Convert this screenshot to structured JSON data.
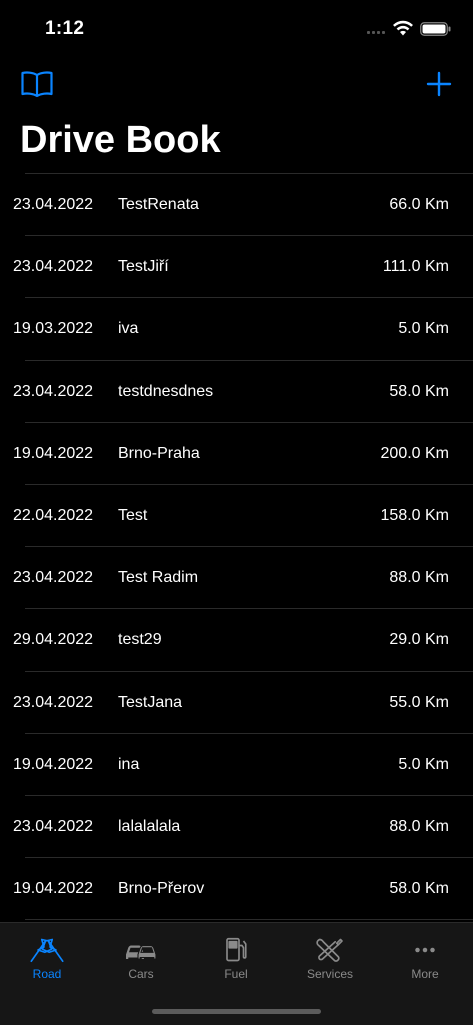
{
  "status_bar": {
    "time": "1:12"
  },
  "nav": {
    "title": "Drive Book",
    "left_icon": "book-icon",
    "right_icon": "plus-icon"
  },
  "colors": {
    "accent": "#0a84ff",
    "background": "#000000",
    "tab_inactive": "#8a8a8a"
  },
  "rides": [
    {
      "date": "23.04.2022",
      "name": "TestRenata",
      "distance": "66.0 Km"
    },
    {
      "date": "23.04.2022",
      "name": "TestJiří",
      "distance": "111.0 Km"
    },
    {
      "date": "19.03.2022",
      "name": "iva",
      "distance": "5.0 Km"
    },
    {
      "date": "23.04.2022",
      "name": "testdnesdnes",
      "distance": "58.0 Km"
    },
    {
      "date": "19.04.2022",
      "name": "Brno-Praha",
      "distance": "200.0 Km"
    },
    {
      "date": "22.04.2022",
      "name": "Test",
      "distance": "158.0 Km"
    },
    {
      "date": "23.04.2022",
      "name": "Test Radim",
      "distance": "88.0 Km"
    },
    {
      "date": "29.04.2022",
      "name": "test29",
      "distance": "29.0 Km"
    },
    {
      "date": "23.04.2022",
      "name": "TestJana",
      "distance": "55.0 Km"
    },
    {
      "date": "19.04.2022",
      "name": "ina",
      "distance": "5.0 Km"
    },
    {
      "date": "23.04.2022",
      "name": "lalalalala",
      "distance": "88.0 Km"
    },
    {
      "date": "19.04.2022",
      "name": "Brno-Přerov",
      "distance": "58.0 Km"
    }
  ],
  "tabs": [
    {
      "label": "Road",
      "icon": "road-flags-icon",
      "active": true
    },
    {
      "label": "Cars",
      "icon": "cars-icon",
      "active": false
    },
    {
      "label": "Fuel",
      "icon": "fuel-pump-icon",
      "active": false
    },
    {
      "label": "Services",
      "icon": "wrench-screwdriver-icon",
      "active": false
    },
    {
      "label": "More",
      "icon": "more-dots-icon",
      "active": false
    }
  ]
}
